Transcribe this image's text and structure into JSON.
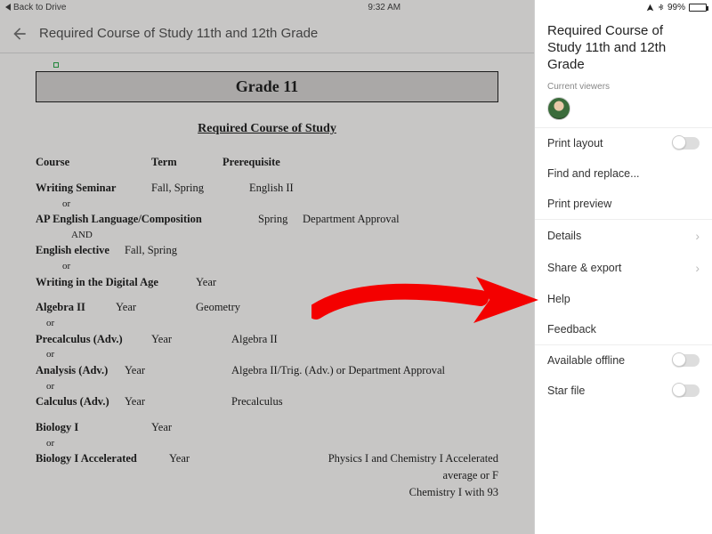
{
  "status": {
    "back_label": "Back to Drive",
    "time": "9:32 AM",
    "battery_percent": "99%"
  },
  "header": {
    "title": "Required Course of Study 11th and 12th Grade"
  },
  "document": {
    "banner": "Grade 11",
    "subtitle": "Required Course of Study",
    "col_headers": {
      "course": "Course",
      "term": "Term",
      "prereq": "Prerequisite"
    },
    "rows": {
      "writing_seminar": {
        "name": "Writing Seminar",
        "term": "Fall, Spring",
        "prereq": "English II"
      },
      "or1": "or",
      "ap_english": {
        "name": "AP English Language/Composition",
        "term": "Spring",
        "prereq": "Department Approval"
      },
      "and1": "AND",
      "english_elective": {
        "name": "English elective",
        "term": "Fall, Spring"
      },
      "or2": "or",
      "writing_digital": {
        "name": "Writing in the Digital Age",
        "term": "Year"
      },
      "algebra2": {
        "name": "Algebra II",
        "term": "Year",
        "prereq": "Geometry"
      },
      "or3": "or",
      "precalc": {
        "name": "Precalculus (Adv.)",
        "term": "Year",
        "prereq": "Algebra II"
      },
      "or4": "or",
      "analysis": {
        "name": "Analysis (Adv.)",
        "term": "Year",
        "prereq": "Algebra II/Trig. (Adv.) or Department Approval"
      },
      "or5": "or",
      "calculus": {
        "name": "Calculus (Adv.)",
        "term": "Year",
        "prereq": "Precalculus"
      },
      "bio1": {
        "name": "Biology I",
        "term": "Year"
      },
      "or6": "or",
      "bio_accel": {
        "name": "Biology I Accelerated",
        "term": "Year",
        "prereq1": "Physics I and Chemistry I Accelerated",
        "prereq2": "average or F",
        "prereq3": "Chemistry I with 93"
      }
    }
  },
  "panel": {
    "title": "Required Course of Study 11th and 12th Grade",
    "viewers_label": "Current viewers",
    "items": {
      "print_layout": "Print layout",
      "find_replace": "Find and replace...",
      "print_preview": "Print preview",
      "details": "Details",
      "share_export": "Share & export",
      "help": "Help",
      "feedback": "Feedback",
      "available_offline": "Available offline",
      "star_file": "Star file"
    }
  }
}
